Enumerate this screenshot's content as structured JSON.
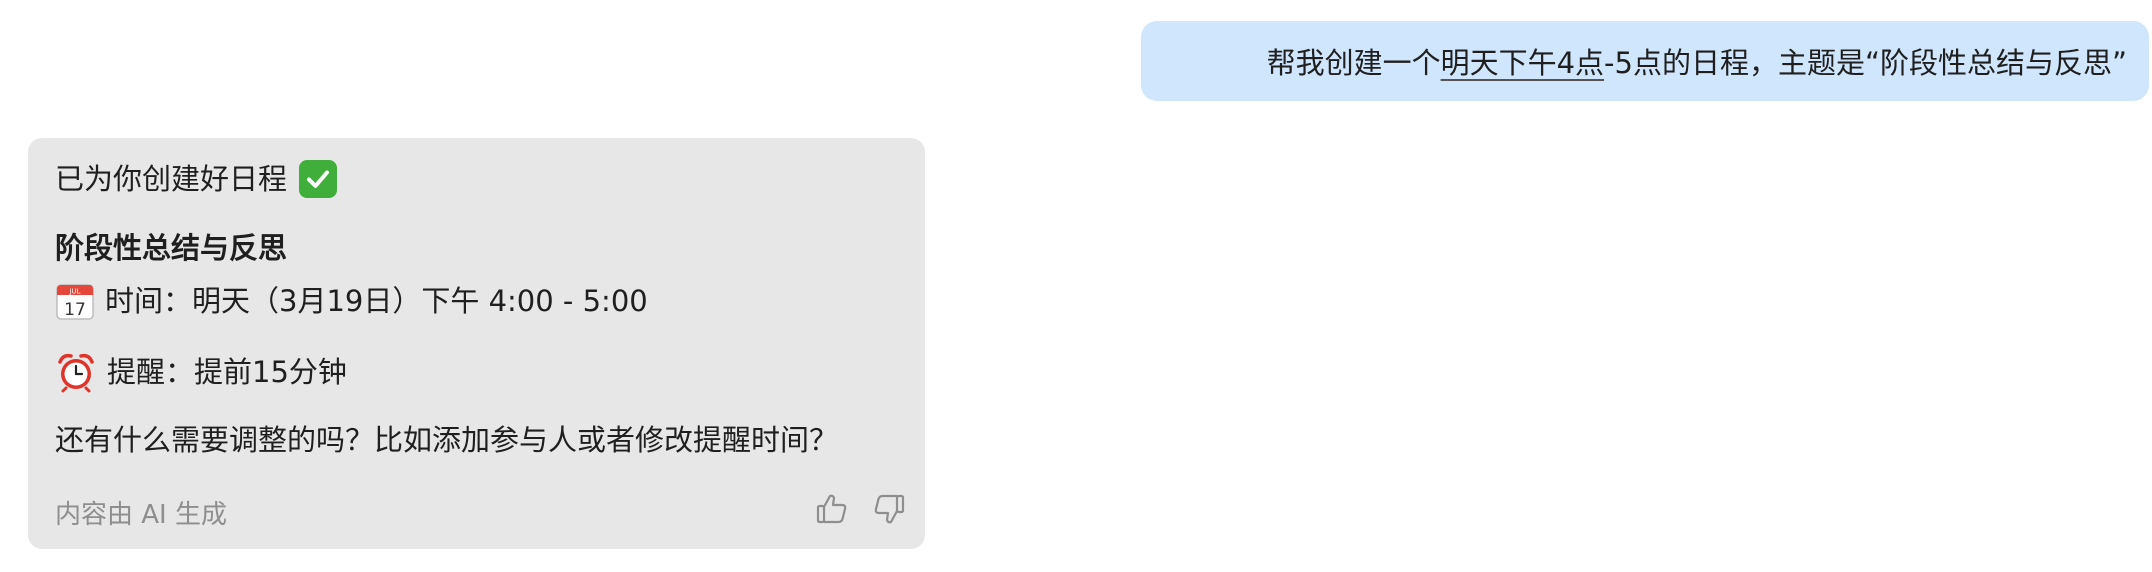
{
  "user_message": {
    "prefix": "帮我创建一个",
    "highlight": "明天下午4点",
    "suffix": "-5点的日程，主题是“阶段性总结与反思”"
  },
  "assistant_message": {
    "created_text": "已为你创建好日程",
    "event_title": "阶段性总结与反思",
    "time_line": "时间：明天（3月19日）下午 4:00 - 5:00",
    "reminder_line": "提醒：提前15分钟",
    "followup_question": "还有什么需要调整的吗？比如添加参与人或者修改提醒时间？",
    "footer_note": "内容由 AI 生成",
    "calendar_icon": {
      "month": "JUL",
      "day": "17"
    },
    "icons": [
      "check-mark-icon",
      "calendar-icon",
      "alarm-clock-icon",
      "thumbs-up-icon",
      "thumbs-down-icon"
    ]
  },
  "colors": {
    "user_bubble_bg": "#cfe6fc",
    "assistant_bubble_bg": "#e7e7e7",
    "check_green": "#3fae3a",
    "clock_red": "#e0342b",
    "footer_gray": "#8e8e8e"
  }
}
